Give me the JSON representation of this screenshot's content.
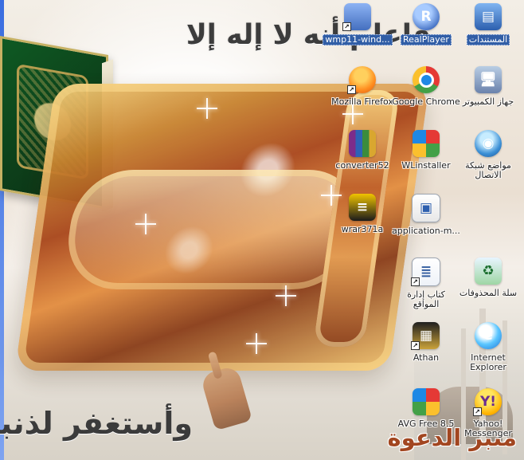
{
  "wallpaper": {
    "header_text": "فاعلم أنه لا إله إلا",
    "footer_text": "وأستغفر لذنبك",
    "banner_text": "منبر الدعوة"
  },
  "icons": [
    {
      "label": "wmp11-wind...",
      "icon": "media-player-icon",
      "selected": true
    },
    {
      "label": "RealPlayer",
      "icon": "realplayer-icon",
      "selected": true
    },
    {
      "label": "المستندات",
      "icon": "documents-icon",
      "selected": true
    },
    {
      "label": "Mozilla Firefox",
      "icon": "firefox-icon"
    },
    {
      "label": "Google Chrome",
      "icon": "chrome-icon"
    },
    {
      "label": "جهاز الكمبيوتر",
      "icon": "computer-icon"
    },
    {
      "label": "converter52",
      "icon": "winrar-icon"
    },
    {
      "label": "WLinstaller",
      "icon": "windows-installer-icon"
    },
    {
      "label": "مواضع شبكة الاتصال",
      "icon": "network-places-icon"
    },
    {
      "label": "wrar371a",
      "icon": "winamp-archive-icon"
    },
    {
      "label": "application-m...",
      "icon": "application-file-icon"
    },
    {
      "label": "كتاب إدارة\nالمواقع",
      "icon": "document-icon"
    },
    {
      "label": "سلة المحذوفات",
      "icon": "recycle-bin-icon"
    },
    {
      "label": "Athan",
      "icon": "athan-icon"
    },
    {
      "label": "Internet\nExplorer",
      "icon": "internet-explorer-icon"
    },
    {
      "label": "AVG Free 8.5",
      "icon": "avg-icon"
    },
    {
      "label": "Yahoo!\nMessenger",
      "icon": "yahoo-messenger-icon"
    }
  ]
}
